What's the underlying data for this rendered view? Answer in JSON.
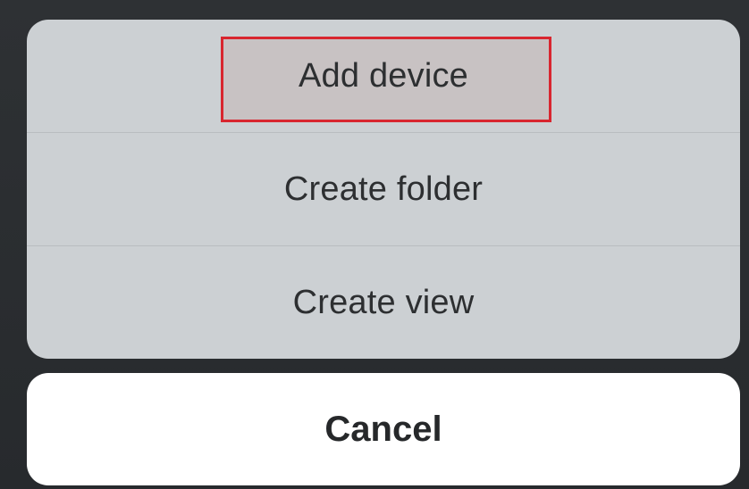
{
  "action_sheet": {
    "items": [
      {
        "label": "Add device"
      },
      {
        "label": "Create folder"
      },
      {
        "label": "Create view"
      }
    ],
    "cancel_label": "Cancel"
  },
  "colors": {
    "sheet_background": "#ccd0d3",
    "highlight_border": "#d8262f",
    "cancel_background": "#ffffff",
    "backdrop": "#2b2e31"
  }
}
